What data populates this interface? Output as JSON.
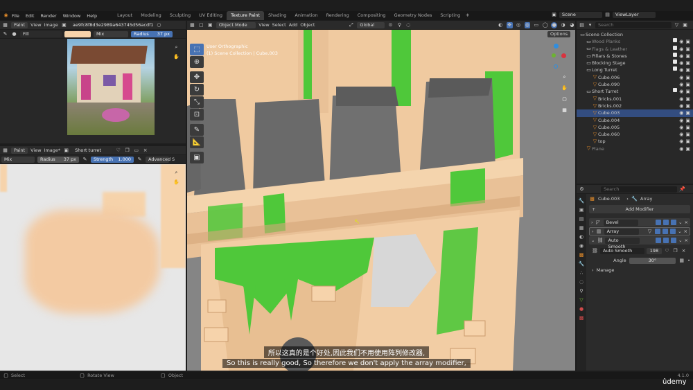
{
  "topbar": {
    "menus": [
      "File",
      "Edit",
      "Render",
      "Window",
      "Help"
    ],
    "workspaces": [
      "Layout",
      "Modeling",
      "Sculpting",
      "UV Editing",
      "Texture Paint",
      "Shading",
      "Animation",
      "Rendering",
      "Compositing",
      "Geometry Nodes",
      "Scripting"
    ],
    "active_workspace": "Texture Paint",
    "scene": "Scene",
    "view_layer": "ViewLayer"
  },
  "image_editor": {
    "mode": "Paint",
    "view": "View",
    "image": "Image",
    "filename": "ae9fc8f8d3e2989a643745d56acdf195.png",
    "tool_fill": "Fill",
    "blend": "Mix",
    "radius_label": "Radius",
    "radius": "37 px"
  },
  "uv_editor": {
    "mode": "Paint",
    "view": "View",
    "image": "Image*",
    "image_name": "Short turret",
    "blend": "Mix",
    "radius_label": "Radius",
    "radius": "37 px",
    "strength_label": "Strength",
    "strength": "1.000",
    "advanced": "Advanced",
    "cut": "S"
  },
  "viewport": {
    "mode": "Object Mode",
    "menus": [
      "View",
      "Select",
      "Add",
      "Object"
    ],
    "orientation": "Global",
    "options": "Options",
    "overlay_line1": "User Orthographic",
    "overlay_line2": "(1) Scene Collection | Cube.003"
  },
  "outliner": {
    "search_placeholder": "Search",
    "root": "Scene Collection",
    "rows": [
      {
        "name": "Wood Planks",
        "dim": true
      },
      {
        "name": "Flags & Leather",
        "dim": true
      },
      {
        "name": "Pillars & Stones",
        "dim": false
      },
      {
        "name": "Blocking Stage",
        "dim": false
      },
      {
        "name": "Long Turret",
        "dim": false
      },
      {
        "name": "Cube.006",
        "dim": false
      },
      {
        "name": "Cube.090",
        "dim": false
      },
      {
        "name": "Short Turret",
        "dim": false
      },
      {
        "name": "Bricks.001",
        "dim": false
      },
      {
        "name": "Bricks.002",
        "dim": false
      },
      {
        "name": "Cube.003",
        "dim": false
      },
      {
        "name": "Cube.004",
        "dim": false
      },
      {
        "name": "Cube.005",
        "dim": false
      },
      {
        "name": "Cube.060",
        "dim": false
      },
      {
        "name": "top",
        "dim": false
      },
      {
        "name": "Plane",
        "dim": true
      }
    ]
  },
  "properties": {
    "search_placeholder": "Search",
    "object": "Cube.003",
    "tab": "Array",
    "add_modifier": "Add Modifier",
    "modifiers": [
      "Bevel",
      "Array",
      "Auto Smooth"
    ],
    "auto_smooth_node": "Auto Smooth",
    "node_users": "198",
    "angle_label": "Angle",
    "angle_value": "30°",
    "manage": "Manage"
  },
  "statusbar": {
    "select": "Select",
    "rotate": "Rotate View",
    "object": "Object",
    "version": "4.1.0"
  },
  "subtitles": {
    "zh": "所以这真的是个好处,因此我们不用使用阵列修改器,",
    "en": "So this is really good, So therefore we don't apply the array modifier,"
  },
  "watermark": "ûdemy",
  "colors": {
    "accent": "#4772b3",
    "skin": "#f6d3ab",
    "moss": "#4fc83a",
    "stone": "#6c6c6c"
  }
}
